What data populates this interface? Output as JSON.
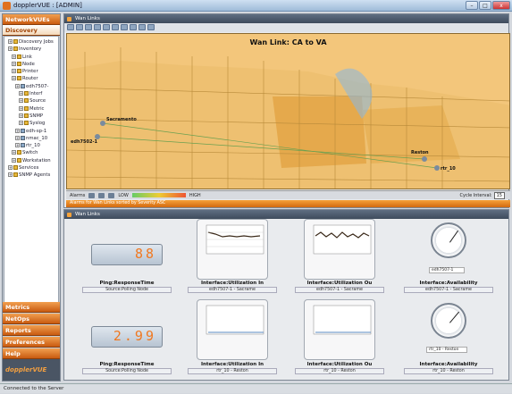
{
  "window": {
    "title": "dopplerVUE : [ADMIN]"
  },
  "sidebar": {
    "header": "NetworkVUEs",
    "selected": "Discovery",
    "tree": [
      {
        "label": "Discovery Jobs",
        "indent": 1,
        "icon": "folder"
      },
      {
        "label": "Inventory",
        "indent": 1,
        "icon": "folder"
      },
      {
        "label": "Link",
        "indent": 2,
        "icon": "folder"
      },
      {
        "label": "Node",
        "indent": 2,
        "icon": "folder"
      },
      {
        "label": "Printer",
        "indent": 2,
        "icon": "folder"
      },
      {
        "label": "Router",
        "indent": 2,
        "icon": "folder"
      },
      {
        "label": "edh7507-",
        "indent": 3,
        "icon": "device"
      },
      {
        "label": "Interf",
        "indent": 4,
        "icon": "folder"
      },
      {
        "label": "Source",
        "indent": 4,
        "icon": "folder"
      },
      {
        "label": "Metric",
        "indent": 4,
        "icon": "folder"
      },
      {
        "label": "SNMP",
        "indent": 4,
        "icon": "folder"
      },
      {
        "label": "Syslog",
        "indent": 4,
        "icon": "folder"
      },
      {
        "label": "edh-sp-1",
        "indent": 3,
        "icon": "device"
      },
      {
        "label": "nmac_10",
        "indent": 3,
        "icon": "device"
      },
      {
        "label": "rtr_10",
        "indent": 3,
        "icon": "device"
      },
      {
        "label": "Switch",
        "indent": 2,
        "icon": "folder"
      },
      {
        "label": "Workstation",
        "indent": 2,
        "icon": "folder"
      },
      {
        "label": "Services",
        "indent": 1,
        "icon": "folder"
      },
      {
        "label": "SNMP Agents",
        "indent": 1,
        "icon": "folder"
      }
    ],
    "bottom": [
      "Metrics",
      "NetOps",
      "Reports",
      "Preferences",
      "Help"
    ],
    "logo": "dopplerVUE"
  },
  "map_pane": {
    "title": "Wan Links",
    "map_title": "Wan Link: CA to VA",
    "cities": [
      "Sacramento",
      "edh7502-1",
      "Reston",
      "rtr_10"
    ],
    "alarms_label": "Alarms",
    "low": "LOW",
    "high": "HIGH",
    "cycle_label": "Cycle Interval:",
    "cycle_value": "15",
    "alarm_strip": "Alarms for Wan Links sorted by Severity ASC"
  },
  "dash_pane": {
    "title": "Wan Links",
    "ping1": {
      "value": "88",
      "caption": "Ping:ResponseTime",
      "sub": "Source:Polling Node"
    },
    "ping2": {
      "value": "2.99",
      "caption": "Ping:ResponseTime",
      "sub": "Source:Polling Node"
    },
    "util1": {
      "caption": "Interface:Utilization In",
      "sub": "edh7507-1 - Sacrame"
    },
    "util2": {
      "caption": "Interface:Utilization Ou",
      "sub": "edh7507-1 - Sacrame"
    },
    "util3": {
      "caption": "Interface:Utilization In",
      "sub": "rtr_10 - Reston"
    },
    "util4": {
      "caption": "Interface:Utilization Ou",
      "sub": "rtr_10 - Reston"
    },
    "avail1": {
      "caption": "Interface:Availability",
      "sub": "edh7507-1 - Sacrame",
      "legend": "edh7507-1"
    },
    "avail2": {
      "caption": "Interface:Availability",
      "sub": "rtr_10 - Reston",
      "legend": "rtr_10 - Reston"
    }
  },
  "status_bar": "Connected to the Server",
  "colors": {
    "accent": "#f0851e",
    "header": "#3e4b5c"
  }
}
